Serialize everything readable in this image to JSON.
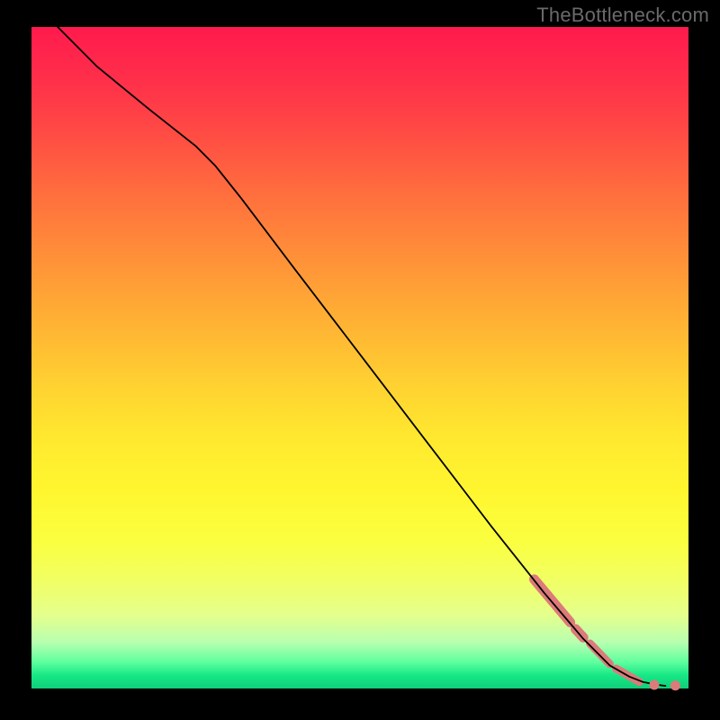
{
  "attribution": "TheBottleneck.com",
  "chart_data": {
    "type": "line",
    "title": "",
    "xlabel": "",
    "ylabel": "",
    "xlim": [
      0,
      100
    ],
    "ylim": [
      0,
      100
    ],
    "series": [
      {
        "name": "curve",
        "x": [
          4,
          10,
          18,
          25,
          28,
          32,
          40,
          50,
          60,
          70,
          78,
          84,
          88,
          91,
          93,
          95,
          96.5
        ],
        "y": [
          100,
          94,
          87.5,
          82,
          79,
          74,
          63.5,
          50.5,
          37.5,
          24.5,
          14.5,
          7.5,
          3.5,
          1.8,
          1.0,
          0.6,
          0.4
        ]
      }
    ],
    "highlight_segments": [
      {
        "x1": 76.5,
        "y1": 16.5,
        "x2": 82.0,
        "y2": 10.0
      },
      {
        "x1": 82.8,
        "y1": 9.0,
        "x2": 84.0,
        "y2": 7.7
      },
      {
        "x1": 85.0,
        "y1": 6.8,
        "x2": 88.0,
        "y2": 3.7
      },
      {
        "x1": 89.0,
        "y1": 3.0,
        "x2": 92.5,
        "y2": 1.0
      }
    ],
    "highlight_points": [
      {
        "x": 94.8,
        "y": 0.55
      },
      {
        "x": 98.0,
        "y": 0.45
      }
    ]
  }
}
